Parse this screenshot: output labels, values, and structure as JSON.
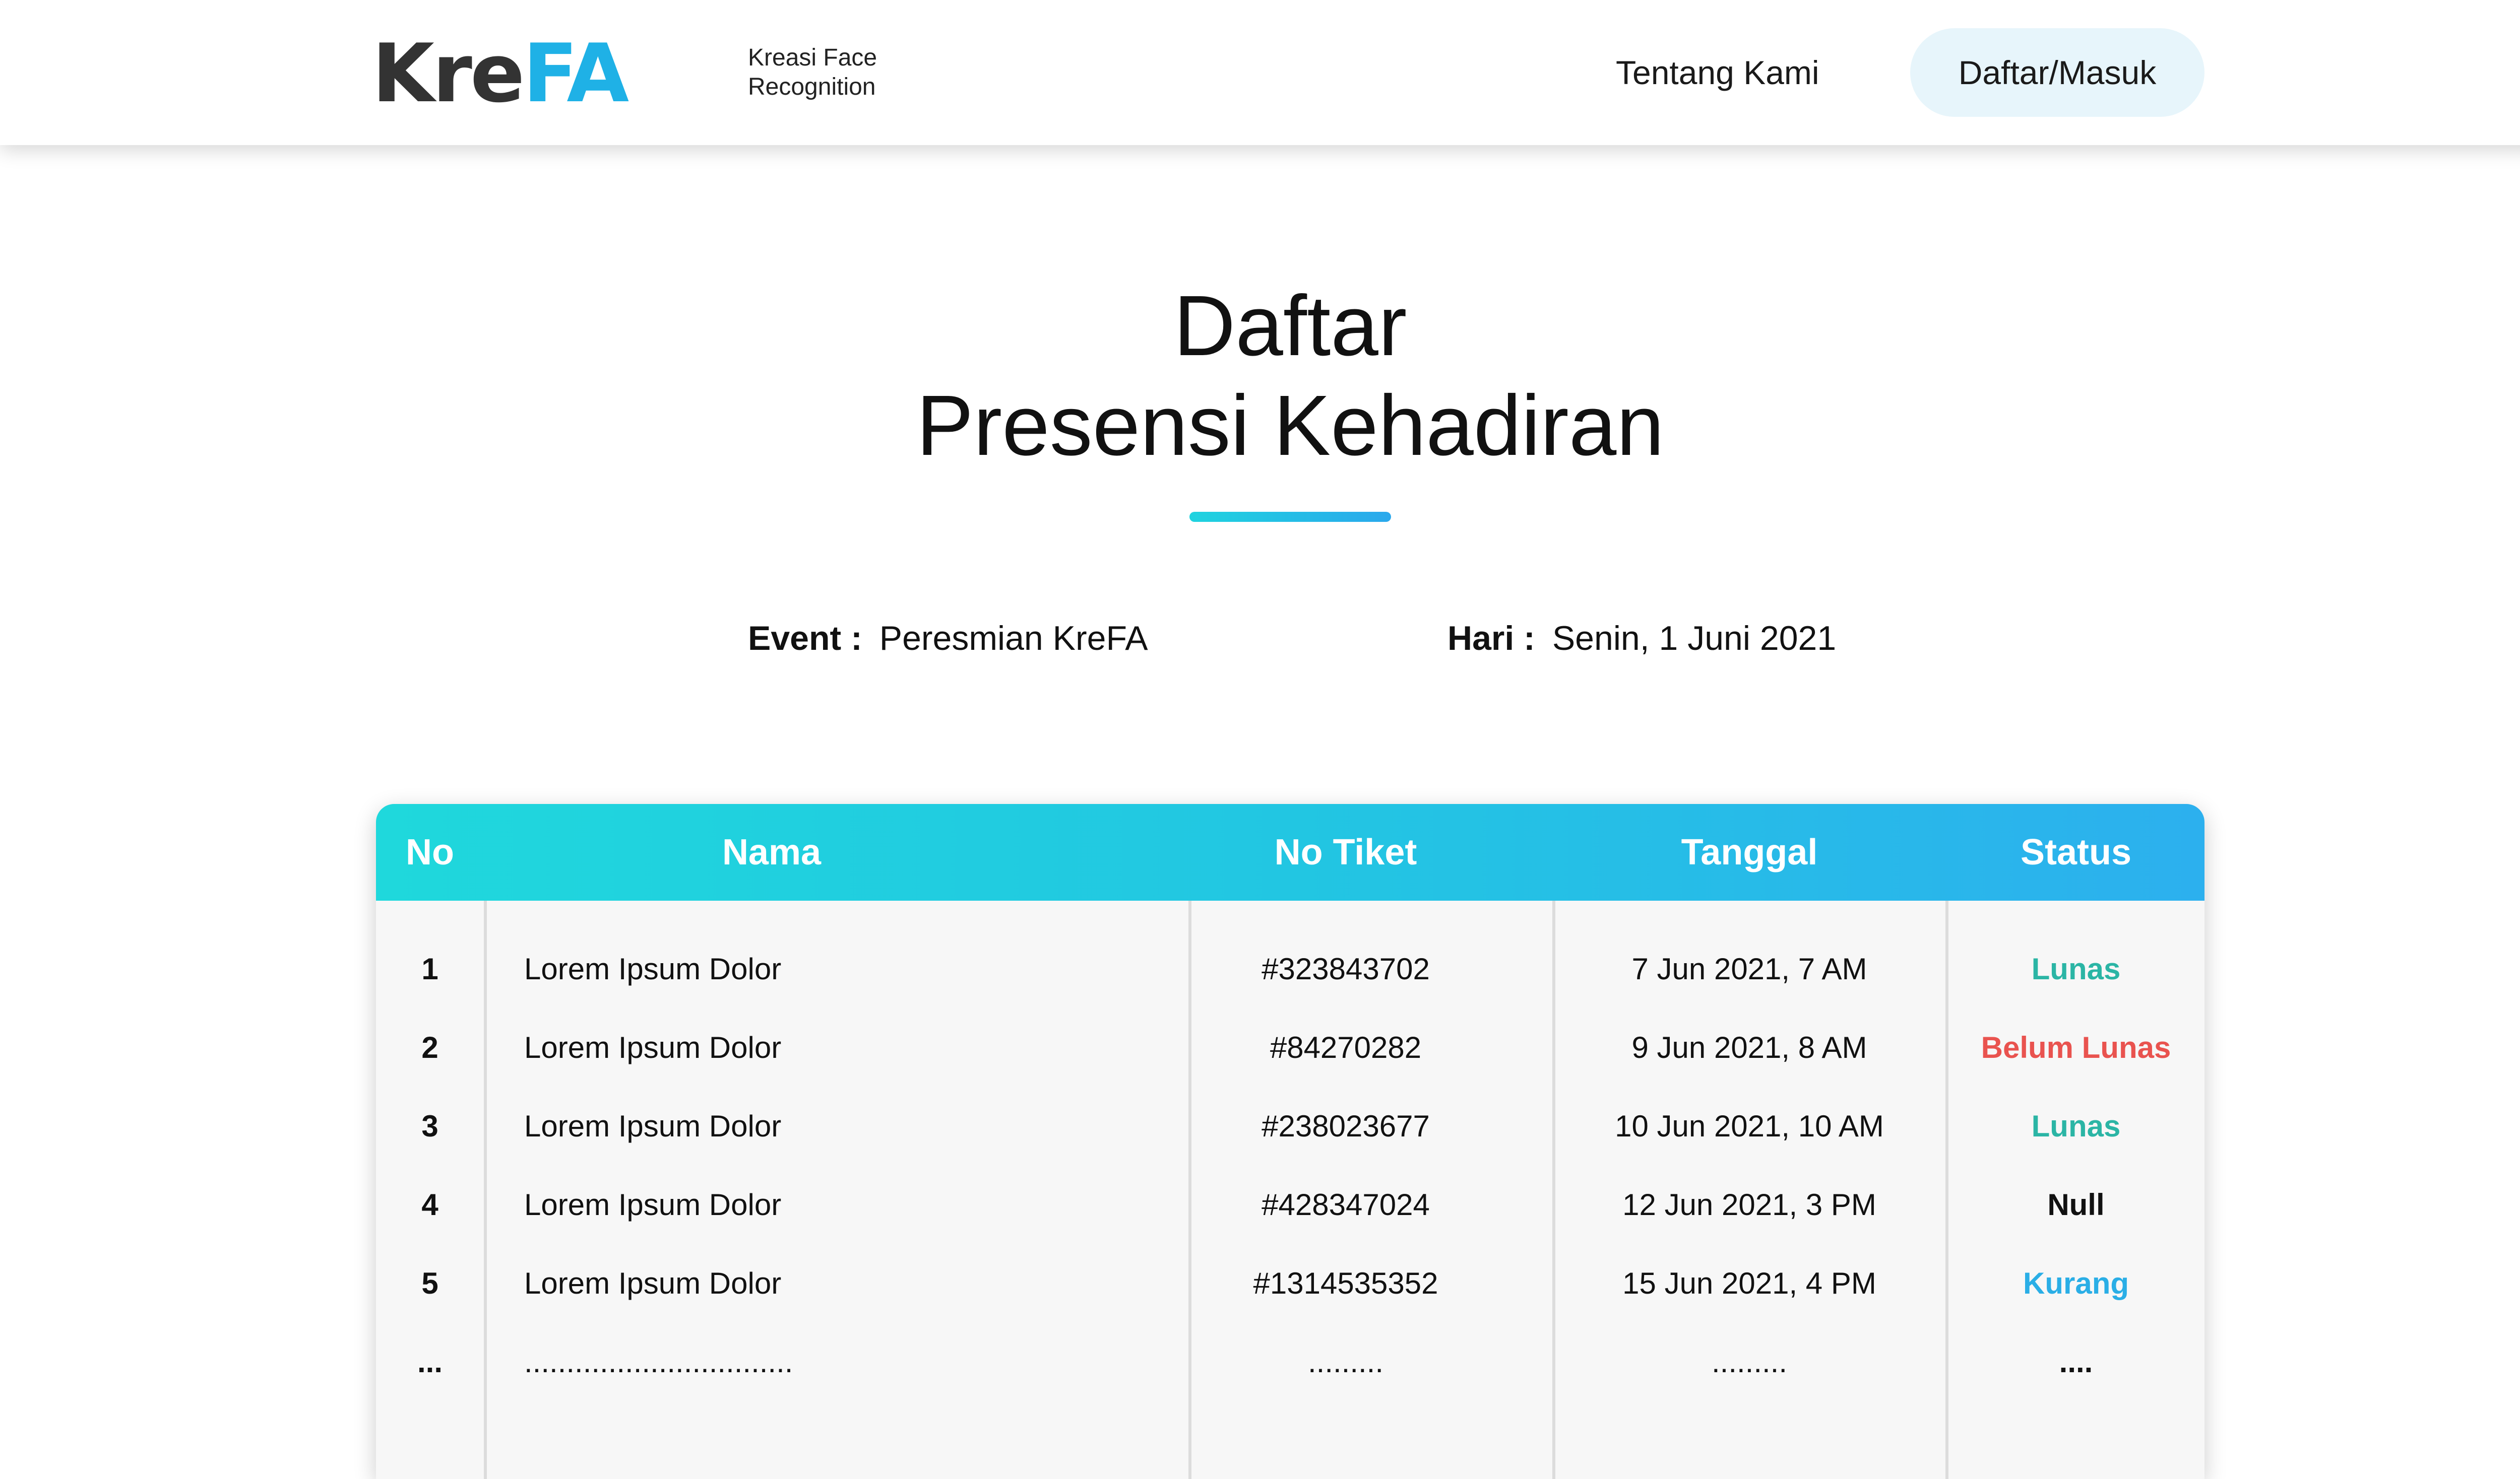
{
  "brand": {
    "logo_part1": "Kre",
    "logo_part2": "FA",
    "tagline_line1": "Kreasi Face",
    "tagline_line2": "Recognition",
    "logo_color_dark": "#333333",
    "logo_color_accent": "#1fb1e6"
  },
  "nav": {
    "about_label": "Tentang Kami",
    "login_label": "Daftar/Masuk"
  },
  "title": {
    "line1": "Daftar",
    "line2": "Presensi Kehadiran"
  },
  "meta": {
    "event_label": "Event :",
    "event_value": "Peresmian KreFA",
    "day_label": "Hari :",
    "day_value": "Senin, 1 Juni 2021"
  },
  "table": {
    "headers": {
      "no": "No",
      "name": "Nama",
      "ticket": "No Tiket",
      "date": "Tanggal",
      "status": "Status"
    },
    "rows": [
      {
        "no": "1",
        "name": "Lorem Ipsum Dolor",
        "ticket": "#323843702",
        "date": "7 Jun 2021, 7 AM",
        "status": "Lunas",
        "status_color": "#2bb5a5"
      },
      {
        "no": "2",
        "name": "Lorem Ipsum Dolor",
        "ticket": "#84270282",
        "date": "9 Jun 2021, 8 AM",
        "status": "Belum Lunas",
        "status_color": "#e9534f"
      },
      {
        "no": "3",
        "name": "Lorem Ipsum Dolor",
        "ticket": "#238023677",
        "date": "10 Jun 2021, 10 AM",
        "status": "Lunas",
        "status_color": "#2bb5a5"
      },
      {
        "no": "4",
        "name": "Lorem Ipsum Dolor",
        "ticket": "#428347024",
        "date": "12 Jun 2021, 3 PM",
        "status": "Null",
        "status_color": "#111111"
      },
      {
        "no": "5",
        "name": "Lorem Ipsum Dolor",
        "ticket": "#1314535352",
        "date": "15 Jun 2021, 4 PM",
        "status": "Kurang",
        "status_color": "#2aaee6"
      },
      {
        "no": "...",
        "name": "................................",
        "ticket": ".........",
        "date": ".........",
        "status": "....",
        "status_color": "#111111"
      }
    ]
  }
}
